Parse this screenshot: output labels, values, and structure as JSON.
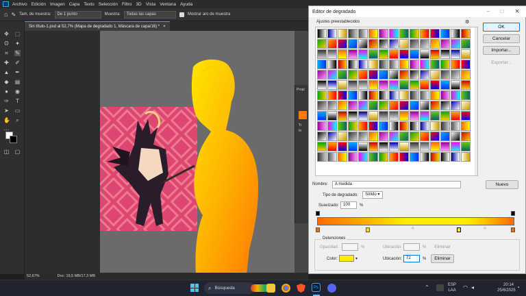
{
  "menubar": {
    "items": [
      "Archivo",
      "Edición",
      "Imagen",
      "Capa",
      "Texto",
      "Selección",
      "Filtro",
      "3D",
      "Vista",
      "Ventana",
      "Ayuda"
    ]
  },
  "options": {
    "sample_size_label": "Tam. de muestra:",
    "sample_size_value": "De 1 punto",
    "sample_label": "Muestra:",
    "sample_value": "Todas las capas",
    "ring_label": "Mostrar aro de muestra"
  },
  "document": {
    "tab_title": "Sin título-1.psd al 52,7% (Mapa de degradado 1, Máscara de capa/16) *",
    "zoom": "52,67%",
    "doc_size": "Doc: 19,5 MB/17,3 MB"
  },
  "props_panel": {
    "title": "Propi",
    "row1": "Tr",
    "row2": "In"
  },
  "dialog": {
    "title": "Editor de degradado",
    "presets_label": "Ajustes preestablecidos",
    "ok_label": "OK",
    "cancel_label": "Cancelar",
    "import_label": "Importar...",
    "export_label": "Exportar...",
    "name_label": "Nombre:",
    "name_value": "A medida",
    "new_label": "Nuevo",
    "type_label": "Tipo de degradado:",
    "type_value": "Sólido",
    "smooth_label": "Suavizado:",
    "smooth_value": "100",
    "percent": "%",
    "stops_label": "Detenciones",
    "opacity_label": "Opacidad:",
    "location_label": "Ubicación:",
    "delete_label": "Eliminar",
    "color_label": "Color:",
    "location_value": "72",
    "colors": {
      "gradient_start": "#ff6a00",
      "gradient_mid": "#ffee00",
      "color_stop": "#ffee00"
    }
  },
  "taskbar": {
    "search_label": "Búsqueda",
    "lang_top": "ESP",
    "lang_bottom": "LAA",
    "time": "20:14",
    "date": "25/6/2025"
  }
}
